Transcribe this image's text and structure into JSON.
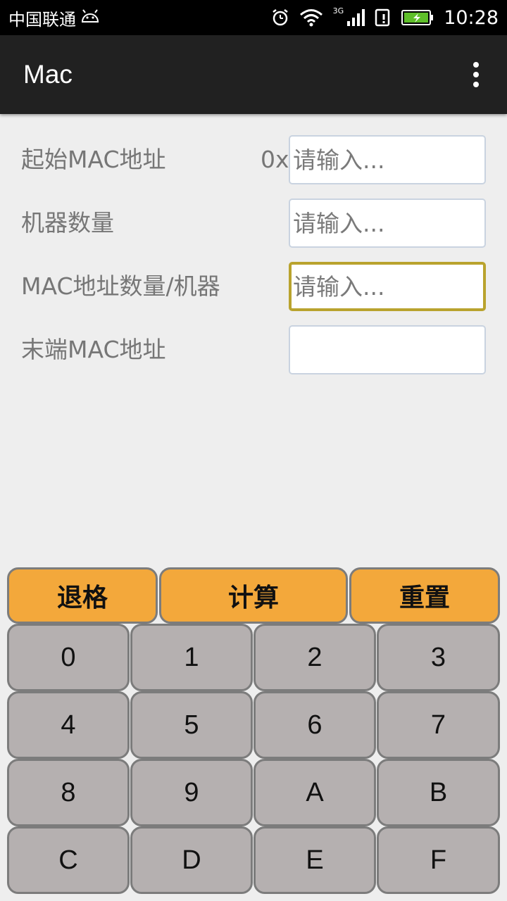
{
  "status_bar": {
    "carrier": "中国联通",
    "network": "3G",
    "time": "10:28"
  },
  "app_bar": {
    "title": "Mac",
    "menu_icon": "overflow-menu-icon"
  },
  "form": {
    "start_mac": {
      "label": "起始MAC地址",
      "prefix": "0x",
      "placeholder": "请输入...",
      "value": ""
    },
    "machine_count": {
      "label": "机器数量",
      "placeholder": "请输入...",
      "value": ""
    },
    "mac_per_machine": {
      "label": "MAC地址数量/机器",
      "placeholder": "请输入...",
      "value": ""
    },
    "end_mac": {
      "label": "末端MAC地址",
      "placeholder": "",
      "value": ""
    }
  },
  "keypad": {
    "actions": [
      "退格",
      "计算",
      "重置"
    ],
    "keys": [
      "0",
      "1",
      "2",
      "3",
      "4",
      "5",
      "6",
      "7",
      "8",
      "9",
      "A",
      "B",
      "C",
      "D",
      "E",
      "F"
    ]
  },
  "colors": {
    "action_key": "#f3a83b",
    "digit_key": "#b5b0b0",
    "focus_border": "#b9a32e",
    "app_bar": "#212121"
  }
}
